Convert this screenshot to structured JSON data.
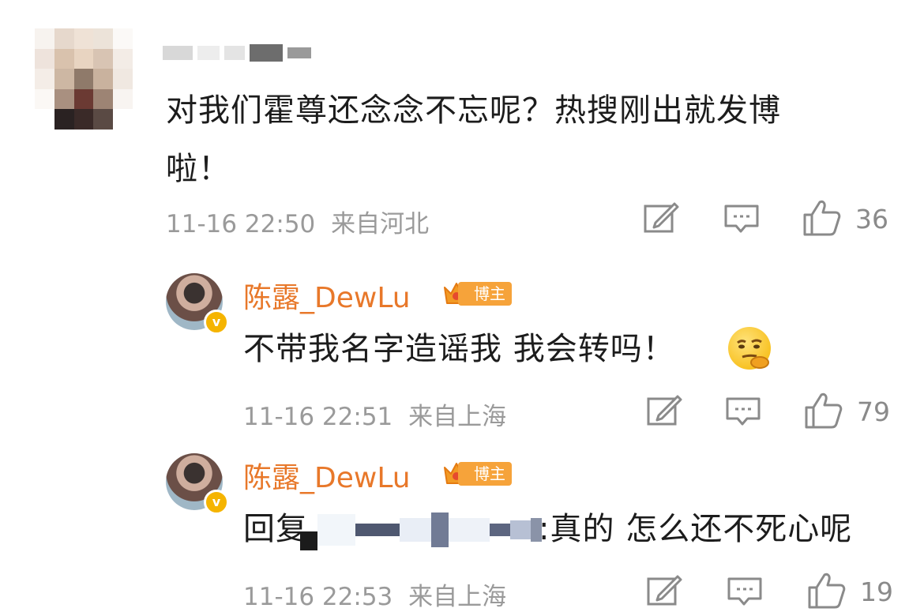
{
  "comments": [
    {
      "username": "",
      "text_line1": "对我们霍尊还念念不忘呢？热搜刚出就发博",
      "text_line2": "啦！",
      "time": "11-16 22:50",
      "location": "来自河北",
      "likes": "36"
    },
    {
      "username": "陈露_DewLu",
      "badge": "博主",
      "text": "不带我名字造谣我 我会转吗！",
      "emoji": "thinking-face",
      "time": "11-16 22:51",
      "location": "来自上海",
      "likes": "79"
    },
    {
      "username": "陈露_DewLu",
      "badge": "博主",
      "reply_prefix": "回复",
      "text": ":真的 怎么还不死心呢",
      "time": "11-16 22:53",
      "location": "来自上海",
      "likes": "19"
    }
  ],
  "icons": {
    "share": "edit-share-icon",
    "comment": "comment-icon",
    "like": "thumbs-up-icon"
  },
  "colors": {
    "username": "#e8782a",
    "badge": "#f6a33a",
    "meta_text": "#9a9a9a"
  }
}
